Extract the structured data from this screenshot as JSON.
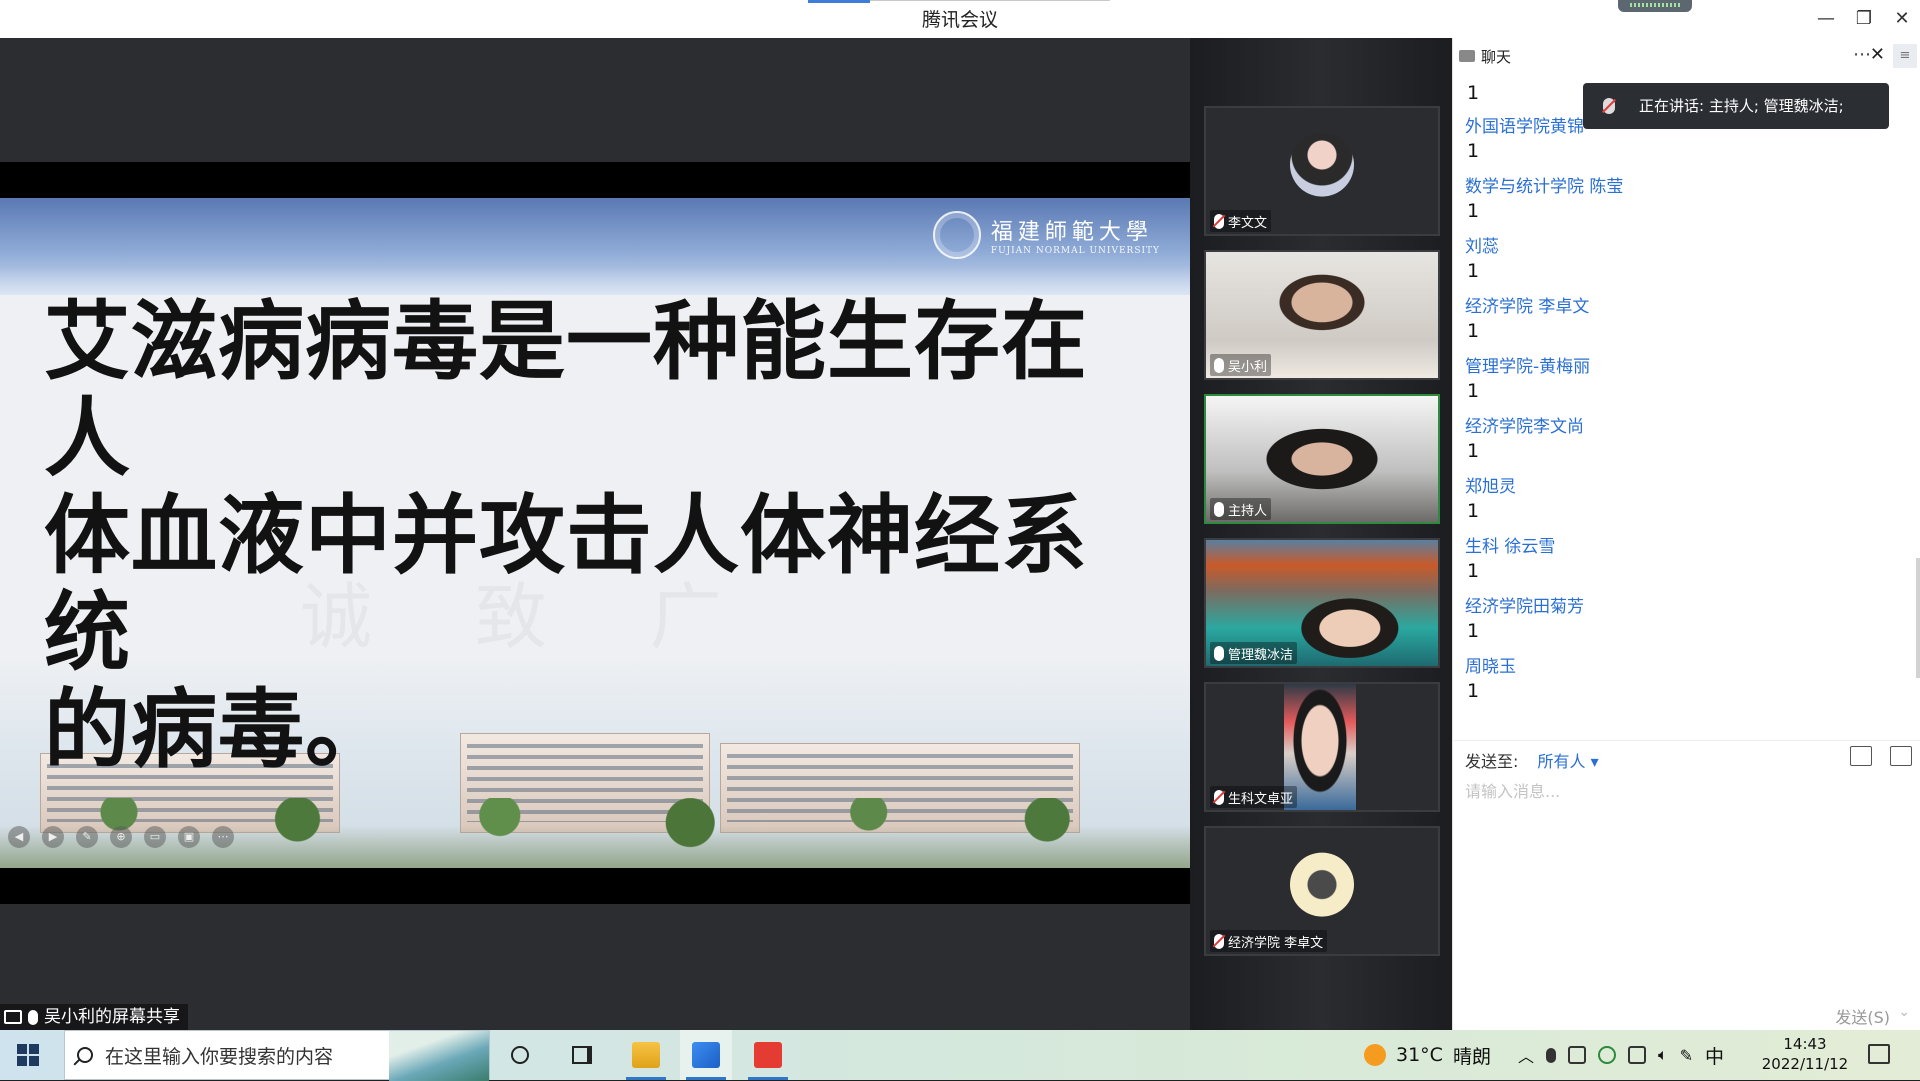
{
  "window": {
    "title": "腾讯会议",
    "controls": {
      "minimize": "—",
      "restore": "❐",
      "close": "✕"
    }
  },
  "slide": {
    "school_cn": "福建師範大學",
    "school_en": "FUJIAN NORMAL UNIVERSITY",
    "text_lines": [
      "艾滋病病毒是一种能生存在人",
      "体血液中并攻击人体神经系统",
      "的病毒。"
    ]
  },
  "share_label": "吴小利的屏幕共享",
  "participants": [
    {
      "name": "李文文",
      "muted": true,
      "kind": "avatar"
    },
    {
      "name": "吴小利",
      "muted": false,
      "kind": "video"
    },
    {
      "name": "主持人",
      "muted": false,
      "kind": "video",
      "active": true
    },
    {
      "name": "管理魏冰洁",
      "muted": false,
      "kind": "video"
    },
    {
      "name": "生科文卓亚",
      "muted": true,
      "kind": "video"
    },
    {
      "name": "经济学院 李卓文",
      "muted": true,
      "kind": "avatar"
    }
  ],
  "chat": {
    "title": "聊天",
    "speaking_now": "正在讲话: 主持人; 管理魏冰洁;",
    "first_line": "1",
    "messages": [
      {
        "sender": "外国语学院黄锦",
        "text": "1"
      },
      {
        "sender": "数学与统计学院 陈莹",
        "text": "1"
      },
      {
        "sender": "刘蕊",
        "text": "1"
      },
      {
        "sender": "经济学院 李卓文",
        "text": "1"
      },
      {
        "sender": "管理学院-黄梅丽",
        "text": "1"
      },
      {
        "sender": "经济学院李文尚",
        "text": "1"
      },
      {
        "sender": "郑旭灵",
        "text": "1"
      },
      {
        "sender": "生科 徐云雪",
        "text": "1"
      },
      {
        "sender": "经济学院田菊芳",
        "text": "1"
      },
      {
        "sender": "周晓玉",
        "text": "1"
      }
    ],
    "send_to_label": "发送至:",
    "send_to_target": "所有人 ▾",
    "input_placeholder": "请输入消息...",
    "send_button": "发送(S)"
  },
  "taskbar": {
    "search_placeholder": "在这里输入你要搜索的内容",
    "weather_temp": "31°C",
    "weather_desc": "晴朗",
    "ime": "中",
    "time": "14:43",
    "date": "2022/11/12"
  },
  "colors": {
    "accent": "#2a6fd3",
    "active_border": "#2e8b3e",
    "muted_red": "#e23b3b"
  }
}
